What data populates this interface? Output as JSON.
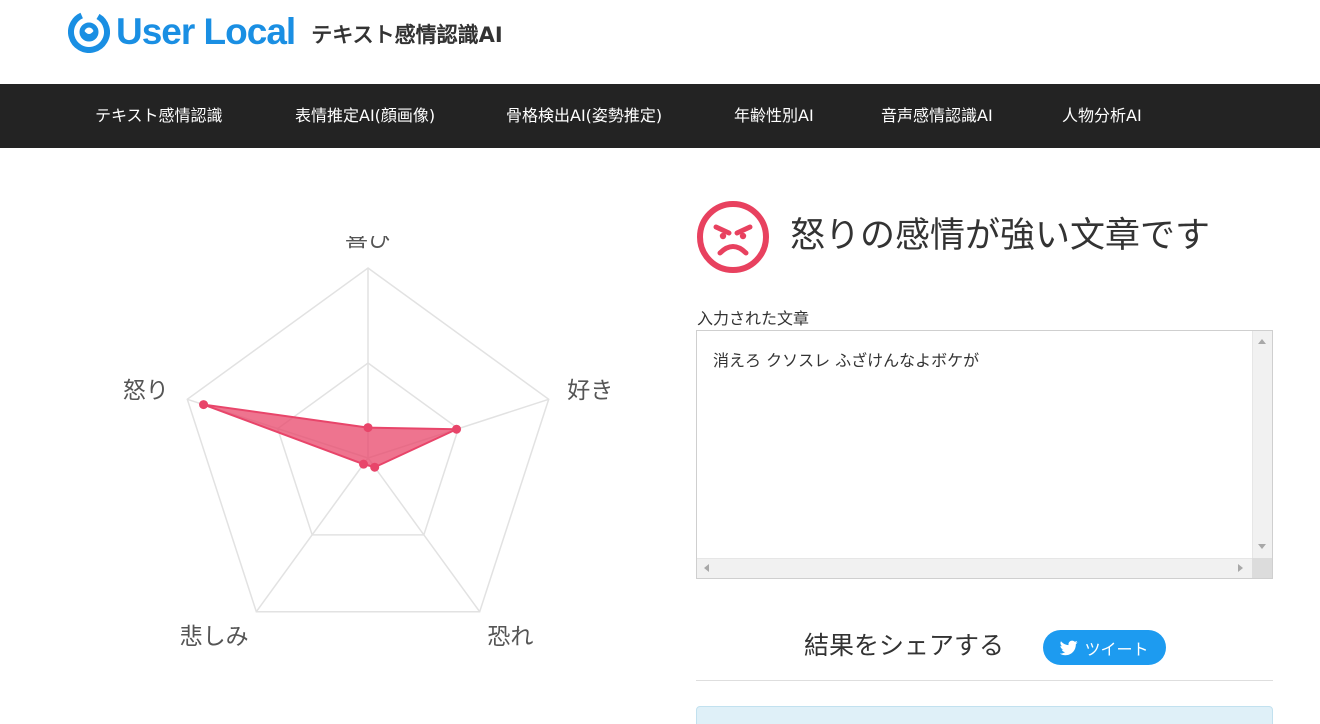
{
  "header": {
    "brand": "User Local",
    "product": "テキスト感情認識AI"
  },
  "nav": {
    "items": [
      {
        "label": "テキスト感情認識"
      },
      {
        "label": "表情推定AI(顔画像)"
      },
      {
        "label": "骨格検出AI(姿勢推定)"
      },
      {
        "label": "年齢性別AI"
      },
      {
        "label": "音声感情認識AI"
      },
      {
        "label": "人物分析AI"
      }
    ]
  },
  "chart_data": {
    "type": "radar",
    "categories": [
      "喜び",
      "好き",
      "恐れ",
      "悲しみ",
      "怒り"
    ],
    "values": [
      0.16,
      0.49,
      0.06,
      0.04,
      0.91
    ],
    "range": [
      0,
      1
    ],
    "grid_levels": [
      0.5,
      1.0
    ],
    "color": "#e8456a"
  },
  "result": {
    "title": "怒りの感情が強い文章です",
    "icon": "angry-face-icon",
    "icon_color": "#e8415f"
  },
  "input": {
    "label": "入力された文章",
    "text": "消えろ クソスレ ふざけんなよボケが"
  },
  "share": {
    "label": "結果をシェアする",
    "tweet_label": "ツイート",
    "tweet_color": "#1d9bf0"
  }
}
